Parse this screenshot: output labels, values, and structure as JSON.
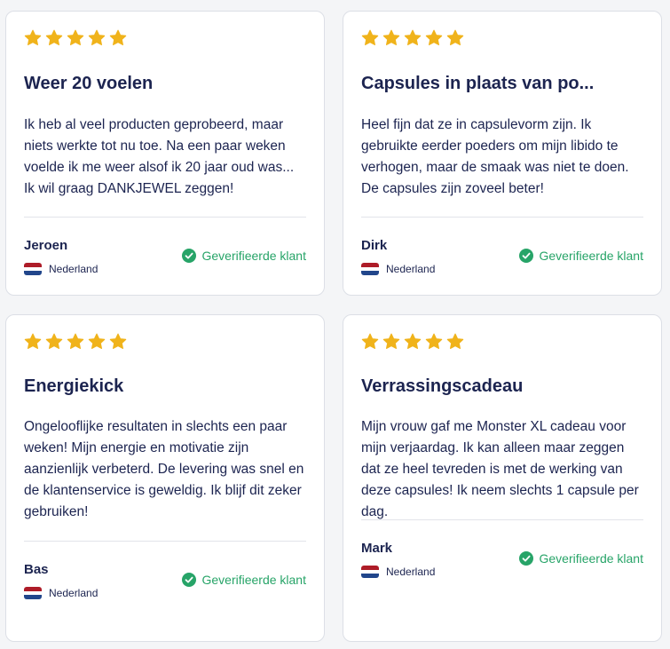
{
  "colors": {
    "star": "#f0b31b",
    "verified": "#27a468",
    "text": "#1c2450",
    "flag_red": "#ae1c28",
    "flag_white": "#ffffff",
    "flag_blue": "#21468b"
  },
  "reviews": [
    {
      "rating": 5,
      "title": "Weer 20 voelen",
      "body": "Ik heb al veel producten geprobeerd, maar niets werkte tot nu toe. Na een paar weken voelde ik me weer alsof ik 20 jaar oud was... Ik wil graag DANKJEWEL zeggen!",
      "author": "Jeroen",
      "country": "Nederland",
      "verified_label": "Geverifieerde klant"
    },
    {
      "rating": 5,
      "title": "Capsules in plaats van po...",
      "body": "Heel fijn dat ze in capsulevorm zijn. Ik gebruikte eerder poeders om mijn libido te verhogen, maar de smaak was niet te doen. De capsules zijn zoveel beter!",
      "author": "Dirk",
      "country": "Nederland",
      "verified_label": "Geverifieerde klant"
    },
    {
      "rating": 5,
      "title": "Energiekick",
      "body": "Ongelooflijke resultaten in slechts een paar weken! Mijn energie en motivatie zijn aanzienlijk verbeterd. De levering was snel en de klantenservice is geweldig. Ik blijf dit zeker gebruiken!",
      "author": "Bas",
      "country": "Nederland",
      "verified_label": "Geverifieerde klant"
    },
    {
      "rating": 5,
      "title": "Verrassingscadeau",
      "body": "Mijn vrouw gaf me Monster XL cadeau voor mijn verjaardag. Ik kan alleen maar zeggen dat ze heel tevreden is met de werking van deze capsules! Ik neem slechts 1 capsule per dag.",
      "author": "Mark",
      "country": "Nederland",
      "verified_label": "Geverifieerde klant"
    }
  ]
}
